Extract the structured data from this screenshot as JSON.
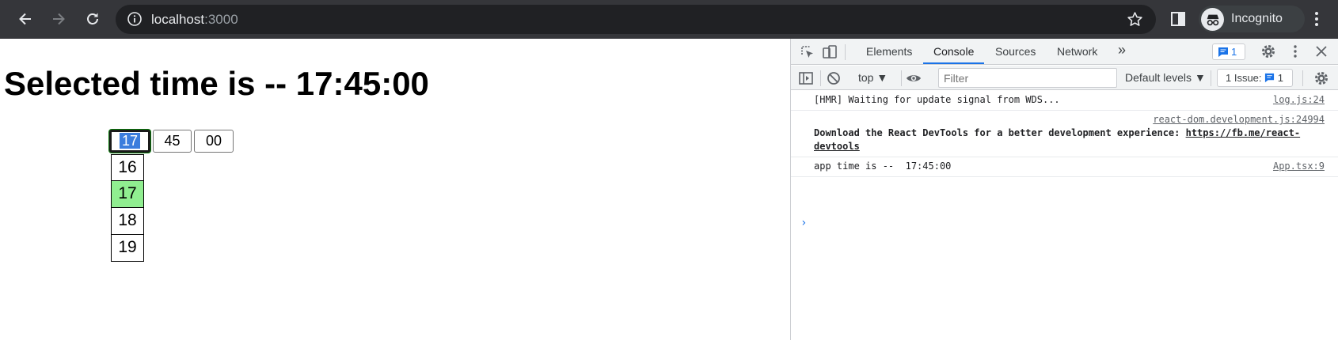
{
  "browser": {
    "url_host": "localhost",
    "url_port": ":3000",
    "profile_label": "Incognito",
    "icons": [
      "back-icon",
      "forward-icon",
      "reload-icon",
      "info-icon",
      "star-icon",
      "sidepanel-icon",
      "incognito-icon",
      "more-icon"
    ]
  },
  "page": {
    "heading": "Selected time is -- 17:45:00",
    "inputs": {
      "hour": "17",
      "minute": "45",
      "second": "00"
    },
    "hour_options": [
      "16",
      "17",
      "18",
      "19"
    ],
    "active_hour": "17",
    "colors": {
      "active_option": "#90ee90",
      "selection": "#3b7ddd",
      "focus_ring": "#0a7a0a"
    }
  },
  "devtools": {
    "tabs": [
      "Elements",
      "Console",
      "Sources",
      "Network"
    ],
    "active_tab": "Console",
    "more_tabs": "»",
    "message_badge": "1",
    "context": "top",
    "filter_placeholder": "Filter",
    "levels": "Default levels",
    "issues_label": "1 Issue:",
    "issues_count": "1",
    "messages": [
      {
        "text": "[HMR] Waiting for update signal from WDS...",
        "source": "log.js:24"
      },
      {
        "text_bold": "Download the React DevTools for a better development experience: ",
        "link": "https://fb.me/react-devtools",
        "source": "react-dom.development.js:24994"
      },
      {
        "text": "app time is --  17:45:00",
        "source": "App.tsx:9"
      }
    ],
    "prompt": "›",
    "accent": "#1a73e8"
  }
}
